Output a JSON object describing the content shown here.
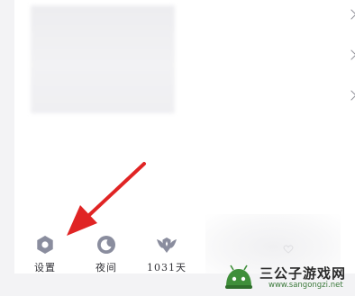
{
  "bottom_bar": {
    "items": [
      {
        "label": "设置",
        "icon": "gear-hexagon-icon"
      },
      {
        "label": "夜间",
        "icon": "moon-icon"
      },
      {
        "label": "1031天",
        "icon": "winged-badge-icon"
      }
    ]
  },
  "annotation": {
    "arrow_color": "#e02424"
  },
  "watermark": {
    "title": "三公子游戏网",
    "url": "www.sangongzi.net"
  },
  "colors": {
    "icon": "#8a8d9e",
    "background": "#f3f3f5",
    "panel": "#ffffff"
  }
}
